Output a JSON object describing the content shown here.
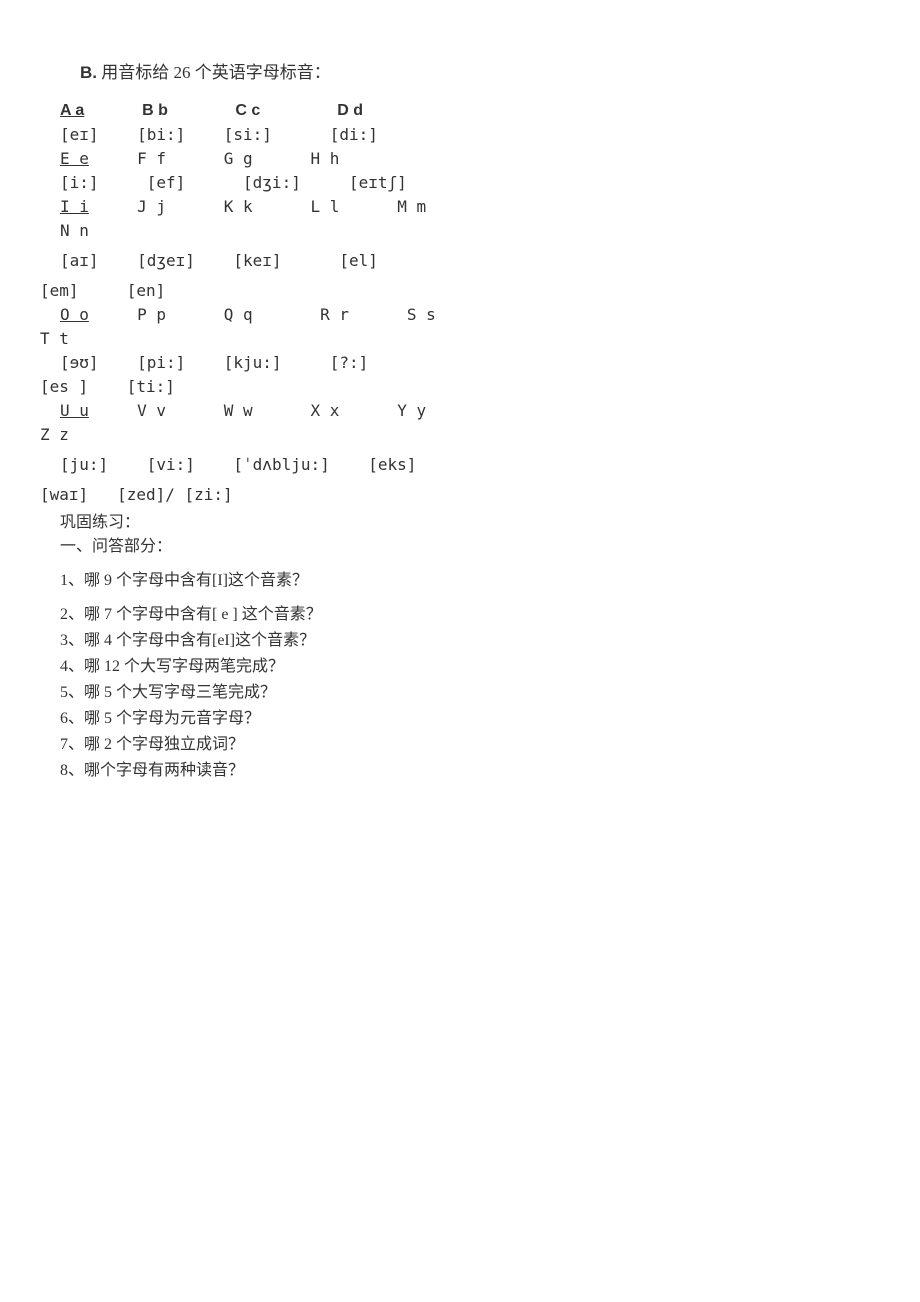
{
  "sectionB": {
    "label": "B.",
    "title": "用音标给 26 个英语字母标音："
  },
  "row1": {
    "Aa": "A a",
    "Bb": "B b",
    "Cc": "C c",
    "Dd": "D d"
  },
  "row2": {
    "Aa_ipa": "[eɪ]",
    "Bb_ipa": "[bi:]",
    "Cc_ipa": "[si:]",
    "Dd_ipa": "[di:]"
  },
  "row3": {
    "Ee": "E e",
    "Ff": "F f",
    "Gg": "G g",
    "Hh": "H h"
  },
  "row4": {
    "Ee_ipa": "[i:]",
    "Ff_ipa": "[ef]",
    "Gg_ipa": "[dʒi:]",
    "Hh_ipa": "[eɪtʃ]"
  },
  "row5": {
    "Ii": "I i",
    "Jj": "J j",
    "Kk": "K k",
    "Ll": "L l",
    "Mm": "M m"
  },
  "row6": {
    "Nn": "N n"
  },
  "row7": {
    "Ii_ipa": "[aɪ]",
    "Jj_ipa": "[dʒeɪ]",
    "Kk_ipa": "[keɪ]",
    "Ll_ipa": "[el]"
  },
  "row8": {
    "Mm_ipa": "[em]",
    "Nn_ipa": "[en]"
  },
  "row9": {
    "Oo": "O o",
    "Pp": "P p",
    "Qq": "Q q",
    "Rr": "R r",
    "Ss": "S s"
  },
  "row10": {
    "Tt": "T t"
  },
  "row11": {
    "Oo_ipa": "[ɘʊ]",
    "Pp_ipa": "[pi:]",
    "Qq_ipa": "[kju:]",
    "Rr_ipa": "[?:]"
  },
  "row12": {
    "Ss_ipa": "[es ]",
    "Tt_ipa": "[ti:]"
  },
  "row13": {
    "Uu": "U u",
    "Vv": "V v",
    "Ww": "W w",
    "Xx": "X x",
    "Yy": "Y y"
  },
  "row14": {
    "Zz": "Z z"
  },
  "row15": {
    "Uu_ipa": "[ju:]",
    "Vv_ipa": "[vi:]",
    "Ww_ipa": "[ˈdʌblju:]",
    "Xx_ipa": "[eks]"
  },
  "row16": {
    "Yy_ipa": "[waɪ]",
    "Zz_ipa": "[zed]/ [zi:]"
  },
  "practice": {
    "title": "巩固练习：",
    "sub": "一、问答部分：",
    "q1": "1、哪 9 个字母中含有[I]这个音素？",
    "q2": "2、哪 7 个字母中含有[ e ] 这个音素？",
    "q3": "3、哪 4 个字母中含有[eI]这个音素？",
    "q4": "4、哪 12 个大写字母两笔完成？",
    "q5": "5、哪 5 个大写字母三笔完成？",
    "q6": "6、哪 5 个字母为元音字母？",
    "q7": "7、哪 2 个字母独立成词？",
    "q8": "8、哪个字母有两种读音？"
  }
}
